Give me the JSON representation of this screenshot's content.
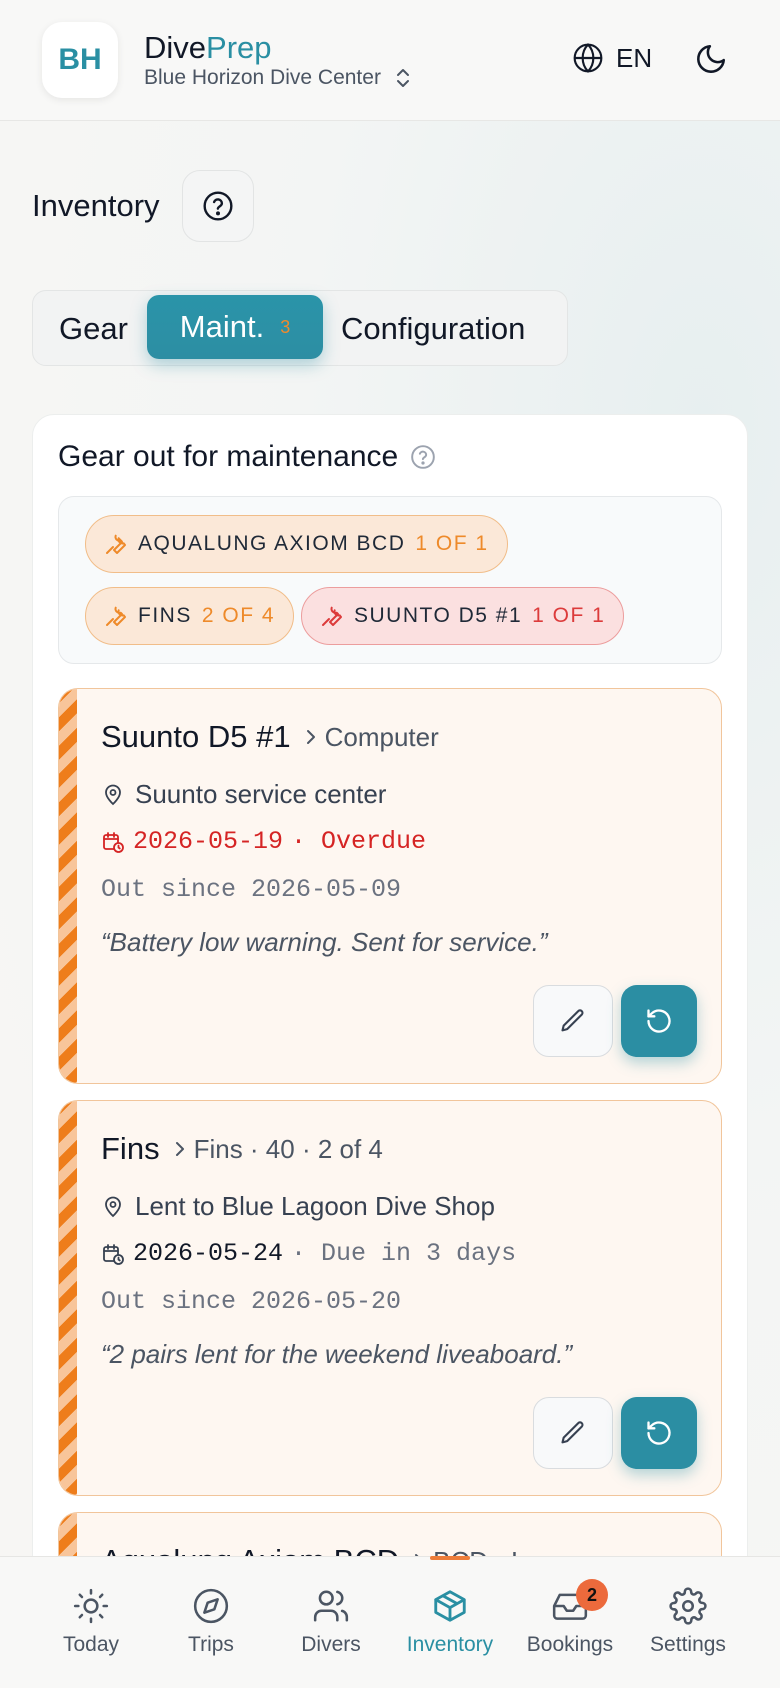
{
  "header": {
    "logo_initials": "BH",
    "brand_part1": "Dive",
    "brand_part2": "Prep",
    "dive_center": "Blue Horizon Dive Center",
    "language": "EN"
  },
  "page": {
    "title": "Inventory"
  },
  "tabs": [
    {
      "label": "Gear"
    },
    {
      "label": "Maint.",
      "count": "3"
    },
    {
      "label": "Configuration"
    }
  ],
  "section": {
    "title": "Gear out for maintenance"
  },
  "chips": [
    {
      "label": "AQUALUNG AXIOM BCD",
      "count": "1 OF 1",
      "tone": "amber"
    },
    {
      "label": "FINS",
      "count": "2 OF 4",
      "tone": "amber"
    },
    {
      "label": "SUUNTO D5 #1",
      "count": "1 OF 1",
      "tone": "red"
    }
  ],
  "items": [
    {
      "name": "Suunto D5 #1",
      "category": "Computer",
      "location": "Suunto service center",
      "due_date": "2026-05-19",
      "due_status": "· Overdue",
      "out_since": "Out since 2026-05-09",
      "note": "“Battery low warning. Sent for service.”"
    },
    {
      "name": "Fins",
      "category": "Fins · 40 · 2 of 4",
      "location": "Lent to Blue Lagoon Dive Shop",
      "due_date": "2026-05-24",
      "due_status": "· Due in 3 days",
      "out_since": "Out since 2026-05-20",
      "note": "“2 pairs lent for the weekend liveaboard.”"
    },
    {
      "name": "Aqualung Axiom BCD",
      "category": "BCD · L"
    }
  ],
  "nav": [
    {
      "label": "Today",
      "icon": "sun-icon"
    },
    {
      "label": "Trips",
      "icon": "compass-icon"
    },
    {
      "label": "Divers",
      "icon": "users-icon"
    },
    {
      "label": "Inventory",
      "icon": "box-icon",
      "active": true
    },
    {
      "label": "Bookings",
      "icon": "inbox-icon",
      "badge": "2"
    },
    {
      "label": "Settings",
      "icon": "gear-icon"
    }
  ],
  "colors": {
    "accent": "#2a8fa3",
    "warning": "#ee8a2a",
    "danger": "#d52424"
  }
}
